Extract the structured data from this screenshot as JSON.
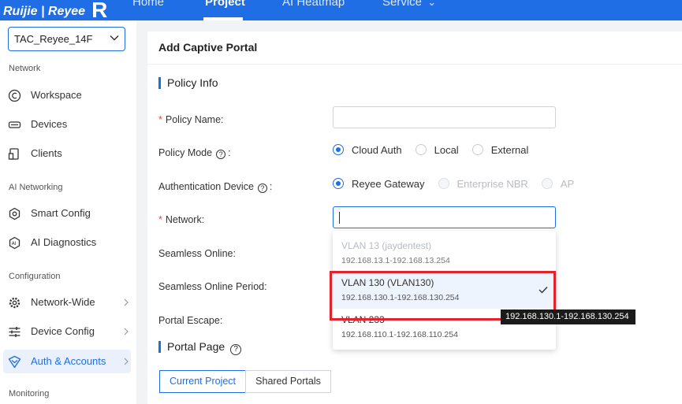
{
  "topnav": {
    "logo": "Ruijie | Reyee",
    "logo_mark": "R",
    "items": [
      {
        "label": "Home",
        "active": false
      },
      {
        "label": "Project",
        "active": true
      },
      {
        "label": "AI Heatmap",
        "active": false
      },
      {
        "label": "Service",
        "active": false
      }
    ],
    "service_chevron": "⌄"
  },
  "sidebar": {
    "project_select": "TAC_Reyee_14F",
    "sections": [
      {
        "title": "Network"
      },
      {
        "title": "AI Networking"
      },
      {
        "title": "Configuration"
      },
      {
        "title": "Monitoring"
      }
    ],
    "items": [
      {
        "label": "Workspace",
        "icon": "workspace-icon"
      },
      {
        "label": "Devices",
        "icon": "devices-icon"
      },
      {
        "label": "Clients",
        "icon": "clients-icon"
      },
      {
        "label": "Smart Config",
        "icon": "smart-config-icon"
      },
      {
        "label": "AI Diagnostics",
        "icon": "ai-diagnostics-icon"
      },
      {
        "label": "Network-Wide",
        "icon": "gear-icon"
      },
      {
        "label": "Device Config",
        "icon": "sliders-icon"
      },
      {
        "label": "Auth & Accounts",
        "icon": "shield-icon",
        "active": true
      }
    ]
  },
  "main": {
    "page_title": "Add Captive Portal",
    "policy_info_title": "Policy Info",
    "fields": {
      "policy_name": {
        "label": "Policy Name",
        "required": "*",
        "colon": ":",
        "value": ""
      },
      "policy_mode": {
        "label": "Policy Mode",
        "help": "?",
        "colon": ":",
        "options": [
          "Cloud Auth",
          "Local",
          "External"
        ],
        "selected": "Cloud Auth"
      },
      "auth_device": {
        "label": "Authentication Device",
        "help": "?",
        "colon": ":",
        "options": [
          "Reyee Gateway",
          "Enterprise NBR",
          "AP"
        ],
        "selected": "Reyee Gateway"
      },
      "network": {
        "label": "Network",
        "required": "*",
        "colon": ":",
        "value": ""
      },
      "seamless_online": {
        "label": "Seamless Online",
        "colon": ":"
      },
      "seamless_period": {
        "label": "Seamless Online Period",
        "colon": ":"
      },
      "portal_escape": {
        "label": "Portal Escape",
        "colon": ":"
      }
    },
    "portal_page_title": "Portal Page",
    "portal_help": "?",
    "portal_tabs": [
      "Current Project",
      "Shared Portals"
    ]
  },
  "dropdown": {
    "options": [
      {
        "name": "VLAN 13 (jaydentest)",
        "range": "192.168.13.1-192.168.13.254",
        "state": "disabled"
      },
      {
        "name": "VLAN 130 (VLAN130)",
        "range": "192.168.130.1-192.168.130.254",
        "state": "selected"
      },
      {
        "name": "VLAN 233",
        "range": "192.168.110.1-192.168.110.254",
        "state": "normal"
      }
    ],
    "tooltip": "192.168.130.1-192.168.130.254"
  },
  "colors": {
    "accent": "#1f6ee6",
    "highlight": "#e3222b",
    "required": "#e24a3b"
  }
}
